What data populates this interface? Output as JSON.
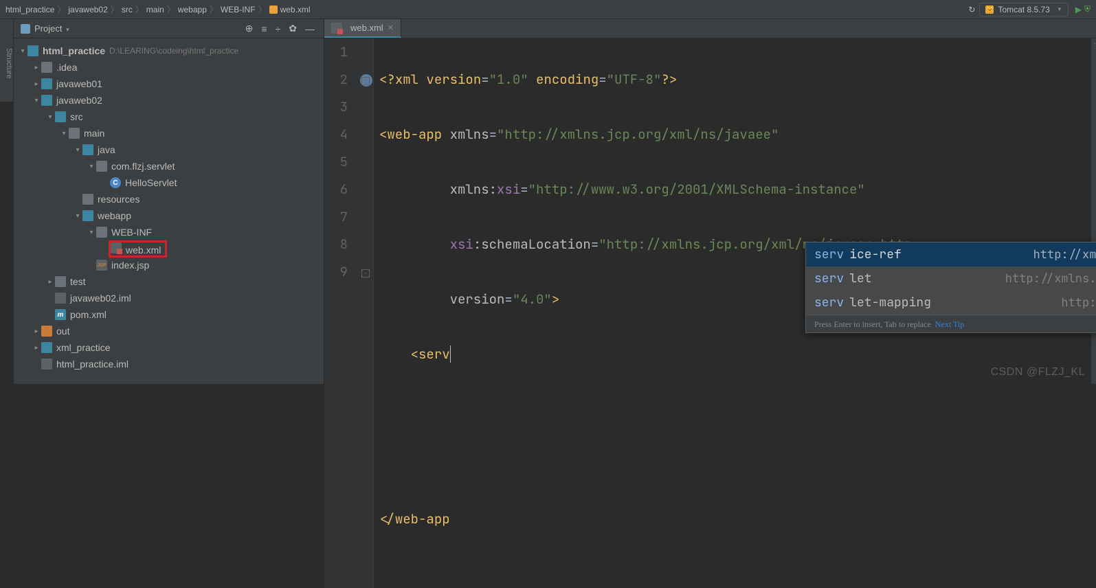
{
  "breadcrumb": [
    "html_practice",
    "javaweb02",
    "src",
    "main",
    "webapp",
    "WEB-INF",
    "web.xml"
  ],
  "run_config": "Tomcat 8.5.73",
  "structure_tab": "Structure",
  "project": {
    "title": "Project",
    "root": {
      "name": "html_practice",
      "path": "D:\\LEARING\\codeing\\html_practice"
    },
    "items": [
      {
        "name": ".idea",
        "icon": "folder",
        "arrow": "right",
        "indent": 1
      },
      {
        "name": "javaweb01",
        "icon": "folder-blue",
        "arrow": "right",
        "indent": 1
      },
      {
        "name": "javaweb02",
        "icon": "folder-blue",
        "arrow": "down",
        "indent": 1
      },
      {
        "name": "src",
        "icon": "folder-blue",
        "arrow": "down",
        "indent": 2
      },
      {
        "name": "main",
        "icon": "folder",
        "arrow": "down",
        "indent": 3
      },
      {
        "name": "java",
        "icon": "folder-blue",
        "arrow": "down",
        "indent": 4
      },
      {
        "name": "com.flzj.servlet",
        "icon": "folder",
        "arrow": "down",
        "indent": 5
      },
      {
        "name": "HelloServlet",
        "icon": "class",
        "arrow": "none",
        "indent": 6,
        "letter": "C"
      },
      {
        "name": "resources",
        "icon": "folder",
        "arrow": "none",
        "indent": 4
      },
      {
        "name": "webapp",
        "icon": "folder-blue",
        "arrow": "down",
        "indent": 4
      },
      {
        "name": "WEB-INF",
        "icon": "folder",
        "arrow": "down",
        "indent": 5
      },
      {
        "name": "web.xml",
        "icon": "xml",
        "arrow": "none",
        "indent": 6,
        "hl": true
      },
      {
        "name": "index.jsp",
        "icon": "jsp",
        "arrow": "none",
        "indent": 5
      },
      {
        "name": "test",
        "icon": "folder",
        "arrow": "right",
        "indent": 2
      },
      {
        "name": "javaweb02.iml",
        "icon": "file",
        "arrow": "none",
        "indent": 2
      },
      {
        "name": "pom.xml",
        "icon": "m",
        "arrow": "none",
        "indent": 2,
        "letter": "m"
      },
      {
        "name": "out",
        "icon": "folder-orange",
        "arrow": "right",
        "indent": 1
      },
      {
        "name": "xml_practice",
        "icon": "folder-blue",
        "arrow": "right",
        "indent": 1
      },
      {
        "name": "html_practice.iml",
        "icon": "file",
        "arrow": "none",
        "indent": 1
      }
    ]
  },
  "tab": {
    "name": "web.xml"
  },
  "code": {
    "lines": 9,
    "l1_a": "<?",
    "l1_b": "xml version",
    "l1_c": "=",
    "l1_d": "\"1.0\"",
    "l1_e": " encoding",
    "l1_f": "=",
    "l1_g": "\"UTF-8\"",
    "l1_h": "?>",
    "l2_a": "<",
    "l2_b": "web-app ",
    "l2_c": "xmlns",
    "l2_d": "=",
    "l2_e": "\"http://xmlns.jcp.org/xml/ns/javaee\"",
    "l3_a": "xmlns:",
    "l3_b": "xsi",
    "l3_c": "=",
    "l3_d": "\"http://www.w3.org/2001/XMLSchema-instance\"",
    "l4_a": "xsi",
    "l4_b": ":",
    "l4_c": "schemaLocation",
    "l4_d": "=",
    "l4_e": "\"http://xmlns.jcp.org/xml/ns/javaee http",
    "l5_a": "version",
    "l5_b": "=",
    "l5_c": "\"4.0\"",
    "l5_d": ">",
    "l6_a": "    <",
    "l6_b": "serv",
    "l9_a": "</",
    "l9_b": "web-app"
  },
  "completion": {
    "items": [
      {
        "m": "serv",
        "rest": "ice-ref",
        "ns": "http://xmlns.jcp.org/xml/n…"
      },
      {
        "m": "serv",
        "rest": "let",
        "ns": "http://xmlns.jcp.org/xml/ns/ja…"
      },
      {
        "m": "serv",
        "rest": "let-mapping",
        "ns": "http://xmlns.jcp.org/x…"
      }
    ],
    "hint": "Press Enter to insert, Tab to replace",
    "tip": "Next Tip"
  },
  "watermark": "CSDN @FLZJ_KL"
}
